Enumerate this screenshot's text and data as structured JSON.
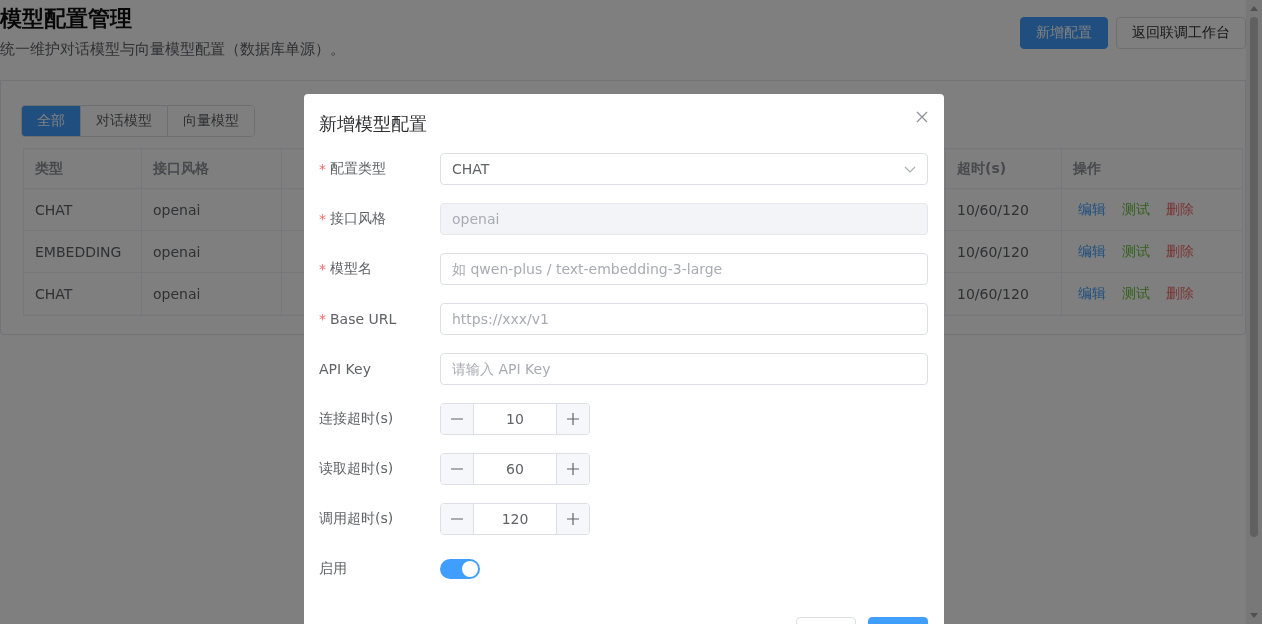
{
  "page": {
    "title": "模型配置管理",
    "subtitle": "统一维护对话模型与向量模型配置（数据库单源）。",
    "actions": [
      {
        "label": "新增配置",
        "kind": "primary"
      },
      {
        "label": "返回联调工作台",
        "kind": "default"
      }
    ]
  },
  "filter_tabs": [
    {
      "label": "全部",
      "selected": true
    },
    {
      "label": "对话模型",
      "selected": false
    },
    {
      "label": "向量模型",
      "selected": false
    }
  ],
  "table": {
    "columns": [
      "类型",
      "接口风格",
      "超时(s)",
      "操作"
    ],
    "rows": [
      {
        "cells": [
          "CHAT",
          "openai",
          "10/60/120"
        ],
        "actions": [
          {
            "label": "编辑",
            "kind": "edit"
          },
          {
            "label": "测试",
            "kind": "test"
          },
          {
            "label": "删除",
            "kind": "delete"
          }
        ]
      },
      {
        "cells": [
          "EMBEDDING",
          "openai",
          "10/60/120"
        ],
        "actions": [
          {
            "label": "编辑",
            "kind": "edit"
          },
          {
            "label": "测试",
            "kind": "test"
          },
          {
            "label": "删除",
            "kind": "delete"
          }
        ]
      },
      {
        "cells": [
          "CHAT",
          "openai",
          "10/60/120"
        ],
        "actions": [
          {
            "label": "编辑",
            "kind": "edit"
          },
          {
            "label": "测试",
            "kind": "test"
          },
          {
            "label": "删除",
            "kind": "delete"
          }
        ]
      }
    ]
  },
  "dialog": {
    "title": "新增模型配置",
    "required_mark": "*",
    "fields": [
      {
        "kind": "select",
        "label": "配置类型",
        "required": true,
        "value": "CHAT"
      },
      {
        "kind": "text",
        "label": "接口风格",
        "required": true,
        "value": "openai",
        "disabled": true
      },
      {
        "kind": "text",
        "label": "模型名",
        "required": true,
        "placeholder": "如 qwen-plus / text-embedding-3-large",
        "disabled": false
      },
      {
        "kind": "text",
        "label": "Base URL",
        "required": true,
        "placeholder": "https://xxx/v1",
        "disabled": false
      },
      {
        "kind": "text",
        "label": "API Key",
        "required": false,
        "placeholder": "请输入 API Key",
        "disabled": false
      },
      {
        "kind": "number",
        "label": "连接超时(s)",
        "required": false,
        "value": "10"
      },
      {
        "kind": "number",
        "label": "读取超时(s)",
        "required": false,
        "value": "60"
      },
      {
        "kind": "number",
        "label": "调用超时(s)",
        "required": false,
        "value": "120"
      },
      {
        "kind": "switch",
        "label": "启用",
        "required": false,
        "on": true
      }
    ],
    "footer_buttons": [
      {
        "kind": "default"
      },
      {
        "kind": "primary"
      }
    ]
  }
}
